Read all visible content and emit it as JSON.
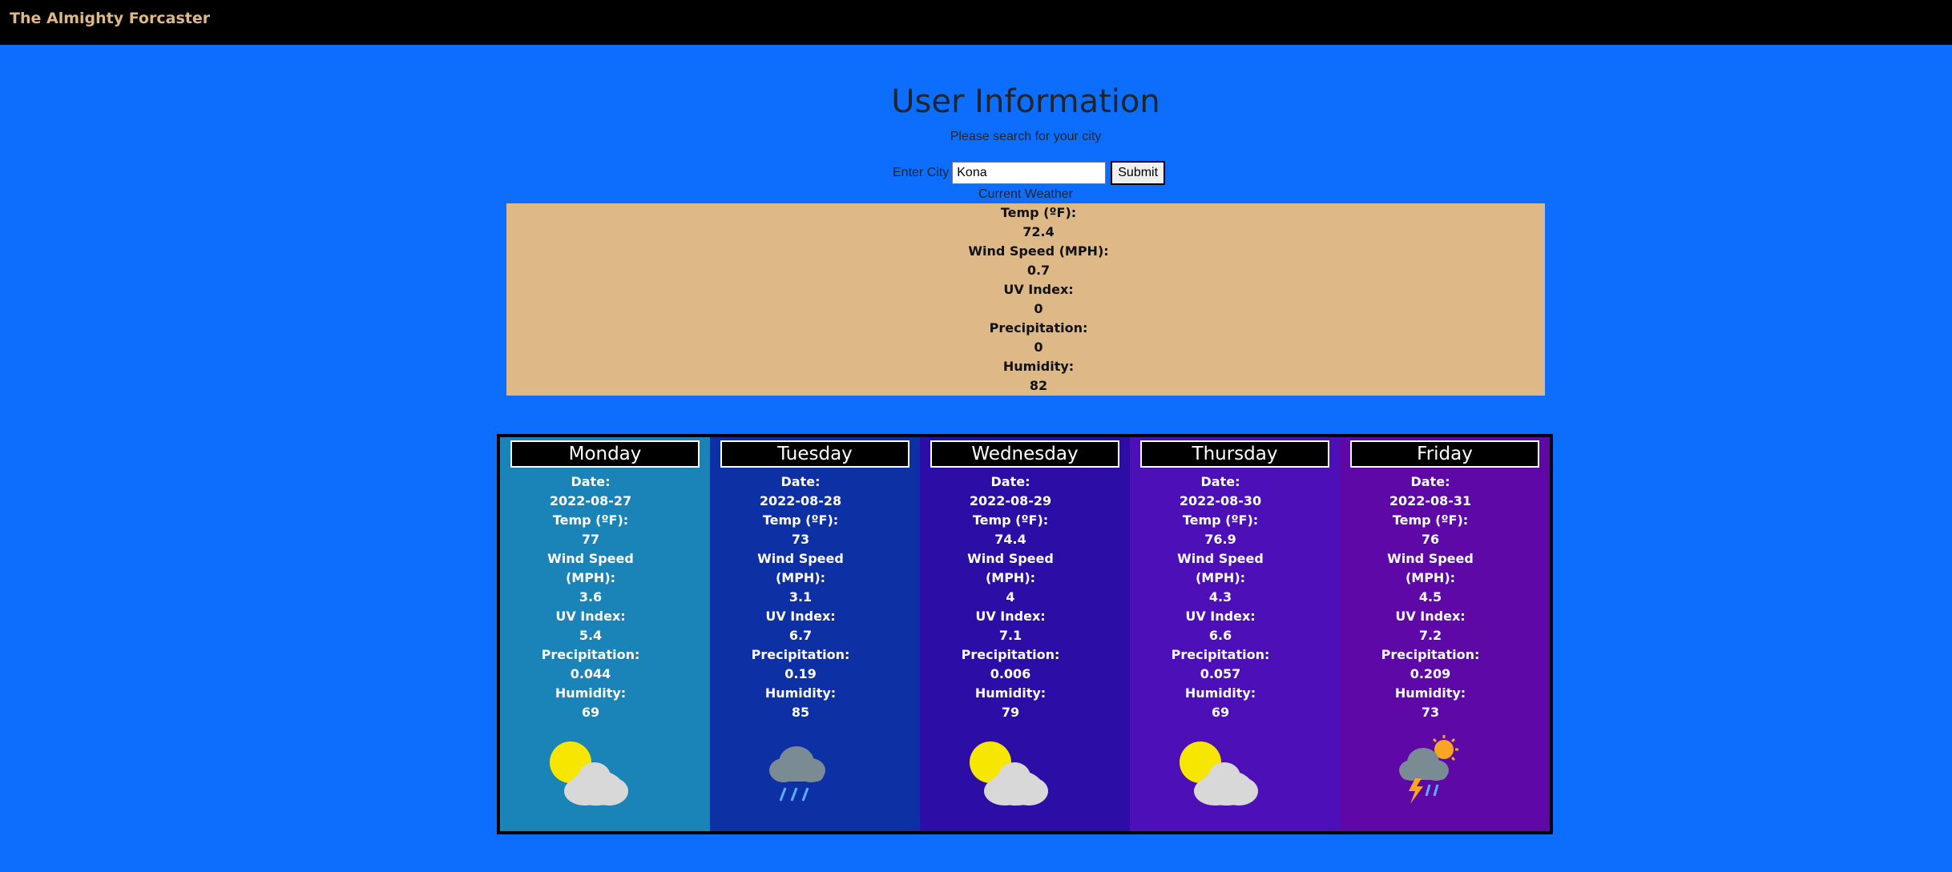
{
  "nav": {
    "brand": "The Almighty Forcaster"
  },
  "header": {
    "title": "User Information",
    "subtitle": "Please search for your city"
  },
  "search": {
    "label": "Enter City",
    "value": "Kona",
    "submit_label": "Submit"
  },
  "current": {
    "heading": "Current Weather",
    "temp_label": "Temp (ºF):",
    "temp": "72.4",
    "wind_label": "Wind Speed (MPH):",
    "wind": "0.7",
    "uv_label": "UV Index:",
    "uv": "0",
    "precip_label": "Precipitation:",
    "precip": "0",
    "humidity_label": "Humidity:",
    "humidity": "82"
  },
  "labels": {
    "date": "Date:",
    "temp": "Temp (ºF):",
    "wind_1": "Wind Speed",
    "wind_2": "(MPH):",
    "uv": "UV Index:",
    "precip": "Precipitation:",
    "humidity": "Humidity:"
  },
  "days": [
    {
      "name": "Monday",
      "date": "2022-08-27",
      "temp": "77",
      "wind": "3.6",
      "uv": "5.4",
      "precip": "0.044",
      "humidity": "69",
      "icon": "partly-cloudy-icon",
      "bg": "#1a84b8"
    },
    {
      "name": "Tuesday",
      "date": "2022-08-28",
      "temp": "73",
      "wind": "3.1",
      "uv": "6.7",
      "precip": "0.19",
      "humidity": "85",
      "icon": "rain-cloud-icon",
      "bg": "#0d31a4"
    },
    {
      "name": "Wednesday",
      "date": "2022-08-29",
      "temp": "74.4",
      "wind": "4",
      "uv": "7.1",
      "precip": "0.006",
      "humidity": "79",
      "icon": "partly-cloudy-icon",
      "bg": "#2c0ea6"
    },
    {
      "name": "Thursday",
      "date": "2022-08-30",
      "temp": "76.9",
      "wind": "4.3",
      "uv": "6.6",
      "precip": "0.057",
      "humidity": "69",
      "icon": "partly-cloudy-icon",
      "bg": "#4d10b8"
    },
    {
      "name": "Friday",
      "date": "2022-08-31",
      "temp": "76",
      "wind": "4.5",
      "uv": "7.2",
      "precip": "0.209",
      "humidity": "73",
      "icon": "thunderstorm-icon",
      "bg": "#5e08a8"
    }
  ]
}
